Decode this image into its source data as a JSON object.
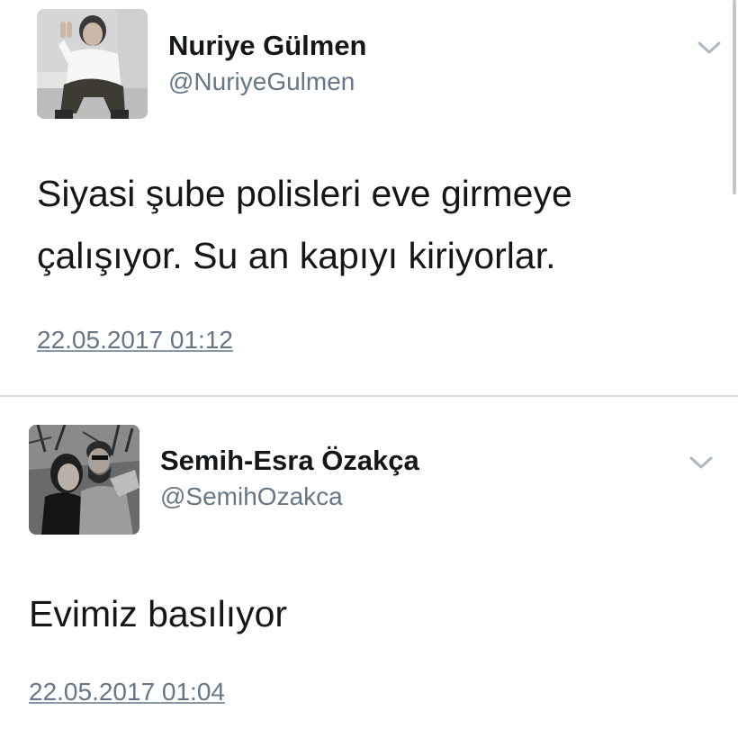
{
  "tweets": [
    {
      "display_name": "Nuriye Gülmen",
      "handle": "@NuriyeGulmen",
      "text_lines": [
        "Siyasi şube polisleri eve girmeye",
        "çalışıyor. Su an kapıyı kiriyorlar."
      ],
      "timestamp": "22.05.2017 01:12",
      "avatar_icon": "person-photo"
    },
    {
      "display_name": "Semih-Esra Özakça",
      "handle": "@SemihOzakca",
      "text_lines": [
        "Evimiz basılıyor"
      ],
      "timestamp": "22.05.2017 01:04",
      "avatar_icon": "couple-photo"
    }
  ],
  "colors": {
    "text": "#14171a",
    "secondary": "#657786",
    "divider": "#d7dce0",
    "chevron": "#aab8c2"
  },
  "icons": {
    "menu": "chevron-down-icon"
  }
}
